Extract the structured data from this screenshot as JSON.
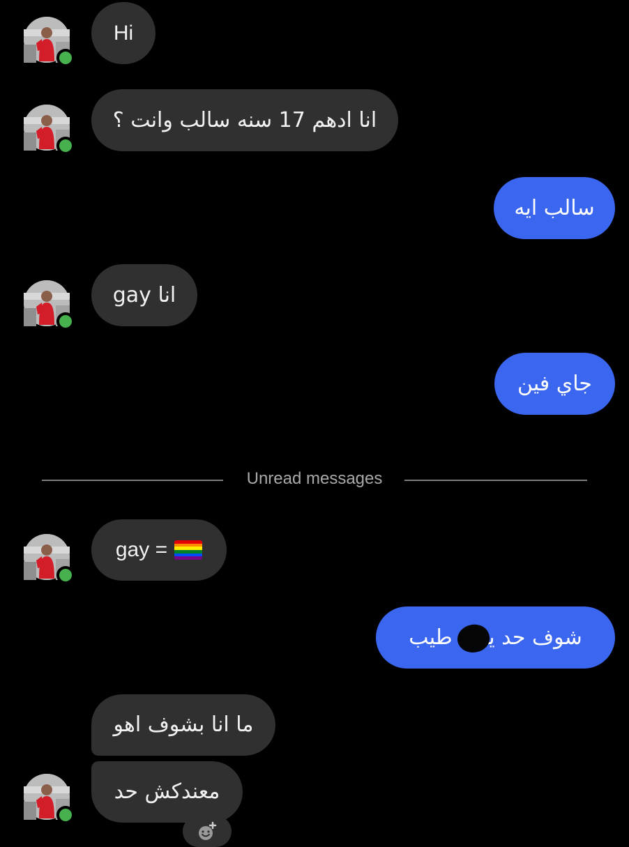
{
  "messages": [
    {
      "id": "m1",
      "direction": "incoming",
      "text": "Hi"
    },
    {
      "id": "m2",
      "direction": "incoming",
      "text": "انا ادهم 17 سنه سالب وانت ؟"
    },
    {
      "id": "m3",
      "direction": "outgoing",
      "text": "سالب ايه"
    },
    {
      "id": "m4",
      "direction": "incoming",
      "text": "انا gay"
    },
    {
      "id": "m5",
      "direction": "outgoing",
      "text": "جاي فين"
    },
    {
      "id": "m6",
      "direction": "incoming",
      "text": "gay ="
    },
    {
      "id": "m7",
      "direction": "outgoing",
      "text": "شوف حد يـ   ك طيب"
    },
    {
      "id": "m8",
      "direction": "incoming",
      "text": "ما انا بشوف اهو"
    },
    {
      "id": "m9",
      "direction": "incoming",
      "text": "معندكش حد"
    }
  ],
  "divider": {
    "label": "Unread messages"
  },
  "colors": {
    "background": "#000000",
    "incoming_bubble": "#303030",
    "outgoing_bubble": "#3b66f0",
    "online": "#47b14f",
    "divider": "#7d7d7d"
  },
  "icons": {
    "online": "online-status-dot",
    "reaction": "add-reaction-icon",
    "flag": "rainbow-flag-emoji"
  }
}
